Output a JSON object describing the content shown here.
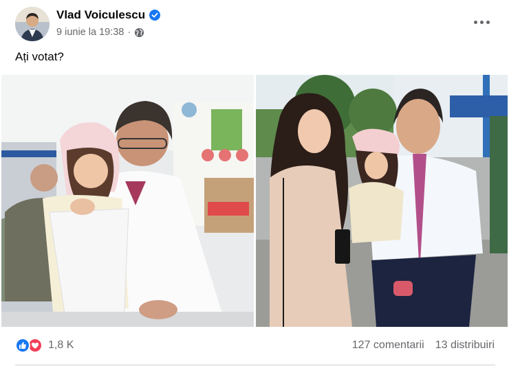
{
  "post": {
    "author": "Vlad Voiculescu",
    "date": "9 iunie la 19:38",
    "separator": "·",
    "text": "Ați votat?",
    "icons": {
      "verified": "verified-badge-icon",
      "audience": "globe-icon",
      "more": "more-options-icon"
    },
    "colors": {
      "accent": "#1877f2",
      "love": "#f33e58",
      "secondary_text": "#65676b"
    }
  },
  "footer": {
    "reaction_count": "1,8 K",
    "comments": "127 comentarii",
    "shares": "13 distribuiri"
  }
}
